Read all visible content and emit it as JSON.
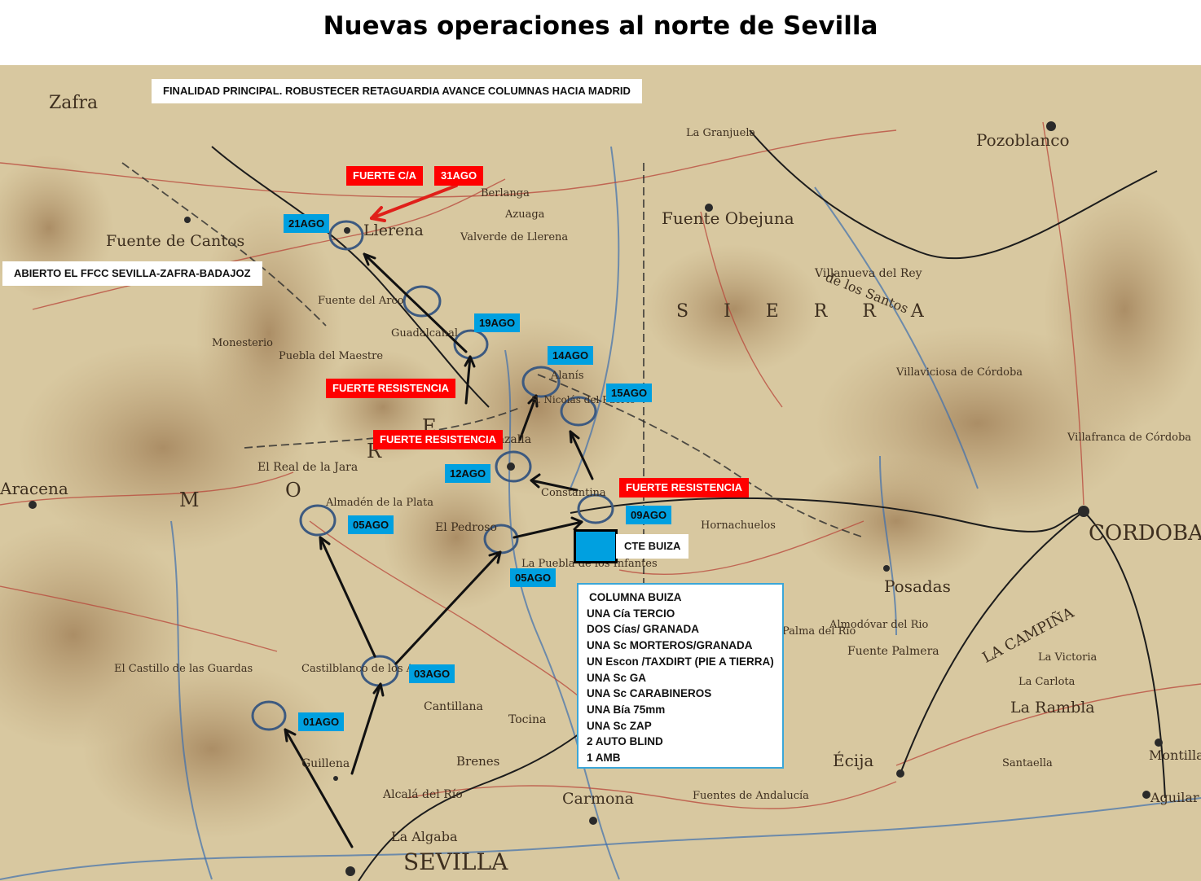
{
  "title": "Nuevas operaciones al norte de Sevilla",
  "notes": {
    "objective": "FINALIDAD PRINCIPAL. ROBUSTECER RETAGUARDIA AVANCE COLUMNAS HACIA MADRID",
    "railway": "ABIERTO EL FFCC SEVILLA-ZAFRA-BADAJOZ"
  },
  "date_labels": [
    "01AGO",
    "03AGO",
    "05AGO",
    "05AGO",
    "09AGO",
    "12AGO",
    "14AGO",
    "15AGO",
    "19AGO",
    "21AGO",
    "31AGO"
  ],
  "resistance_labels": {
    "fuerte_ca": "FUERTE  C/A",
    "r1": "FUERTE  RESISTENCIA",
    "r2": "FUERTE  RESISTENCIA",
    "r3": "FUERTE  RESISTENCIA"
  },
  "commander": "CTE BUIZA",
  "column": {
    "title": "COLUMNA BUIZA",
    "units": [
      "UNA Cía TERCIO",
      "DOS Cías/ GRANADA",
      "UNA Sc MORTEROS/GRANADA",
      "UN Escon /TAXDIRT (PIE A TIERRA)",
      "UNA Sc GA",
      "UNA Sc CARABINEROS",
      "UNA Bía 75mm",
      "UNA Sc ZAP",
      "2 AUTO BLIND",
      "1 AMB"
    ]
  },
  "places": {
    "zafra": "Zafra",
    "fuente_cantos": "Fuente de Cantos",
    "llerena": "Llerena",
    "berlanga": "Berlanga",
    "azuaga": "Azuaga",
    "valverde": "Valverde de Llerena",
    "fuente_obejuna": "Fuente Obejuna",
    "pozoblanco": "Pozoblanco",
    "villanueva_rey": "Villanueva del Rey",
    "los_santos": "de los Santos",
    "villaviciosa": "Villaviciosa de Córdoba",
    "villafranca": "Villafranca de Córdoba",
    "cordoba": "CORDOBA",
    "posadas": "Posadas",
    "palma_rio": "Palma del Rio",
    "fuente_palmera": "Fuente Palmera",
    "la_campina": "LA CAMPIÑA",
    "la_rambla": "La Rambla",
    "ecija": "Écija",
    "carmona": "Carmona",
    "sevilla": "SEVILLA",
    "la_algaba": "La Algaba",
    "alcala_rio": "Alcalá del Río",
    "brenes": "Brenes",
    "tocina": "Tocina",
    "cantillana": "Cantillana",
    "guillena": "Guillena",
    "castilblanco": "Castilblanco de los Arroyos",
    "el_pedroso": "El Pedroso",
    "almaden": "Almadén de la Plata",
    "real_jara": "El Real de la Jara",
    "aracena": "Aracena",
    "cazalla": "Cazalla",
    "constantina": "Constantina",
    "guadalcanal": "Guadalcanal",
    "fuente_arco": "Fuente del Arco",
    "puebla_maestre": "Puebla del Maestre",
    "monesterio": "Monesterio",
    "hornachuelos": "Hornachuelos",
    "almodovar": "Almodóvar del Rio",
    "alanis": "Alanís",
    "san_nicolas": "S. Nicolás del Puerto",
    "la_puebla_infantes": "La Puebla de los Infantes",
    "fuentes_andalucia": "Fuentes de Andalucía",
    "granjuela": "La Granjuela",
    "montilla": "Montilla",
    "aguilar": "Aguilar",
    "castillo_guardas": "El Castillo de las Guardas",
    "santaella": "Santaella",
    "la_victoria": "La Victoria",
    "la_carlota": "La Carlota",
    "sierra": "S I E R R A",
    "sierra_morena_m": "M",
    "sierra_morena_o": "O",
    "sierra_morena_r": "R",
    "sierra_morena_e": "E"
  },
  "colors": {
    "circle": "#3d5a80",
    "arrow_black": "#111111",
    "arrow_red": "#e0201a",
    "label_blue": "#00a0e0",
    "label_red": "#ff0000",
    "map_base": "#d6c59c"
  }
}
